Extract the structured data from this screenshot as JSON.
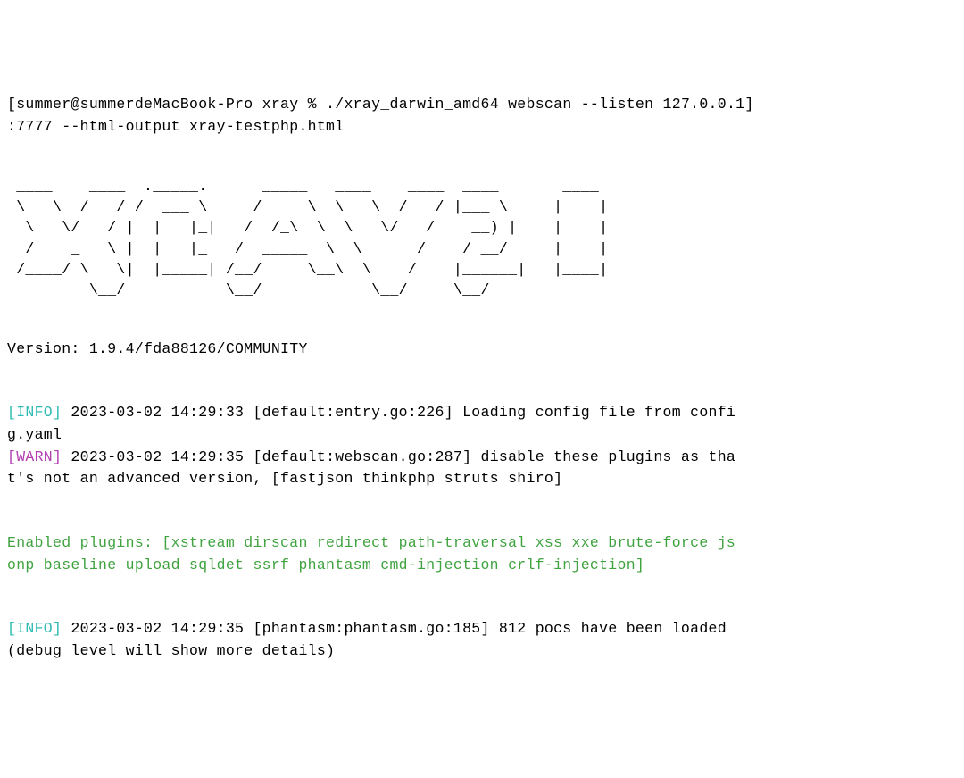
{
  "prompt": {
    "leading_bracket": "[",
    "user_host": "summer@summerdeMacBook-Pro",
    "directory": "xray",
    "separator": "%",
    "command": "./xray_darwin_amd64 webscan --listen 127.0.0.1]\n:7777 --html-output xray-testphp.html"
  },
  "ascii_art": " ____    ____  ._____.      _____   ____    ____  ____       ____\n \\   \\  /   / /  ___ \\     /     \\  \\   \\  /   / |___ \\     |    |\n  \\   \\/   / |  |   |_|   /  /_\\  \\  \\   \\/   /    __) |    |    |\n  /    _   \\ |  |   |_   /  _____  \\  \\      /    / __/     |    |\n /____/ \\   \\|  |_____| /__/     \\__\\  \\    /    |______|   |____|\n         \\__/           \\__/            \\__/     \\__/",
  "version": "Version: 1.9.4/fda88126/COMMUNITY",
  "logs": {
    "info1": {
      "tag": "[INFO]",
      "text": " 2023-03-02 14:29:33 [default:entry.go:226] Loading config file from confi\ng.yaml"
    },
    "warn1": {
      "tag": "[WARN]",
      "text": " 2023-03-02 14:29:35 [default:webscan.go:287] disable these plugins as tha\nt's not an advanced version, [fastjson thinkphp struts shiro]"
    },
    "enabled": "Enabled plugins: [xstream dirscan redirect path-traversal xss xxe brute-force js\nonp baseline upload sqldet ssrf phantasm cmd-injection crlf-injection]",
    "info2": {
      "tag": "[INFO]",
      "text": " 2023-03-02 14:29:35 [phantasm:phantasm.go:185] 812 pocs have been loaded \n(debug level will show more details)"
    }
  }
}
